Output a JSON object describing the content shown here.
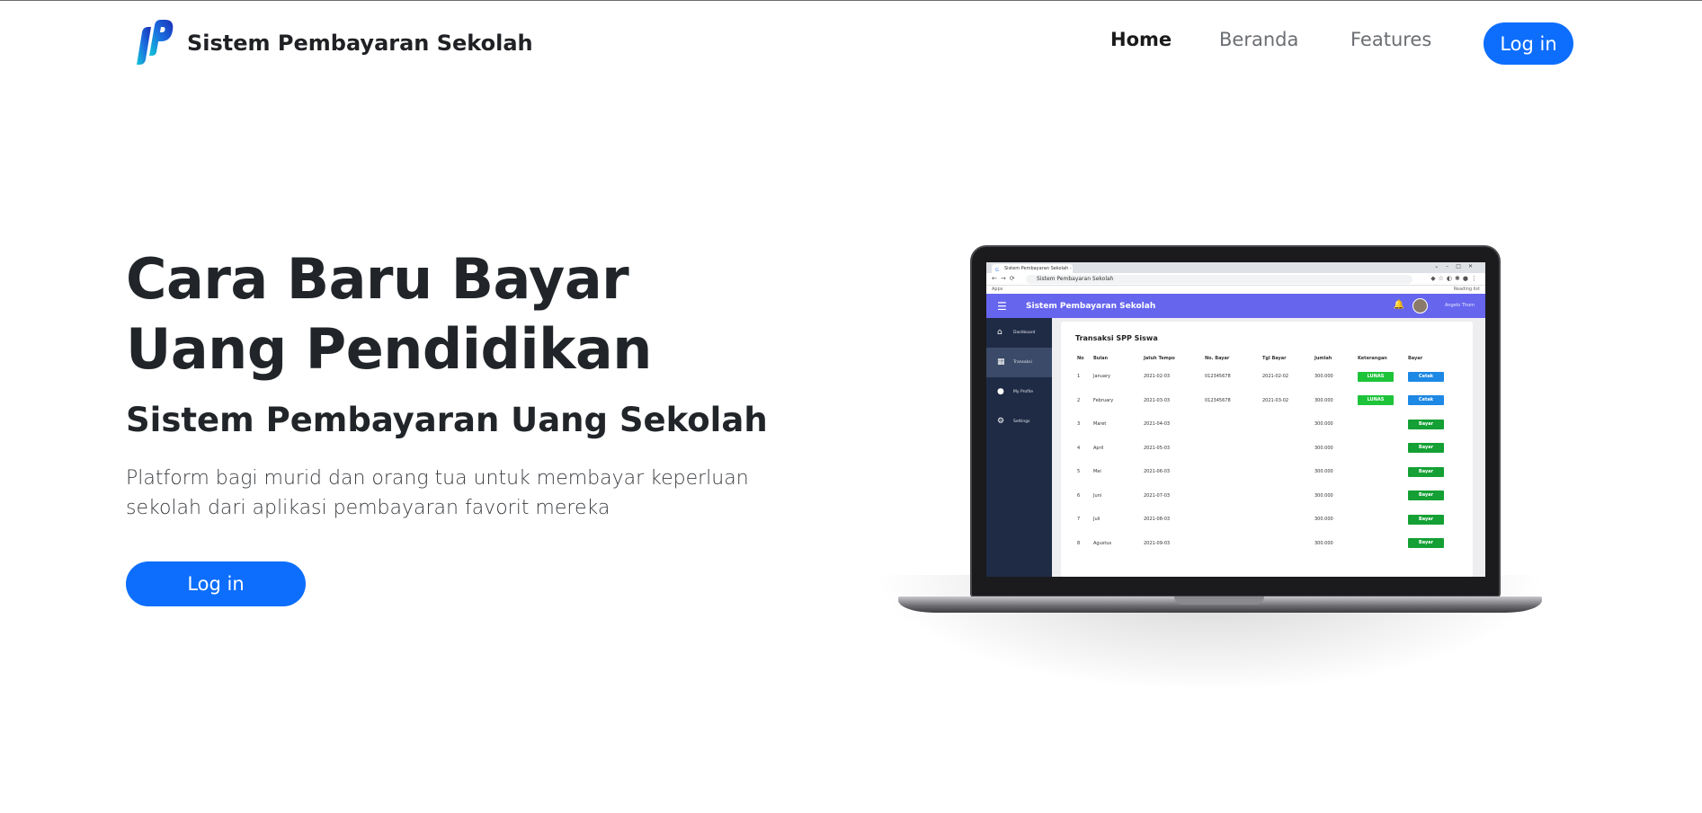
{
  "navbar": {
    "brand_text": "Sistem Pembayaran Sekolah",
    "links": {
      "home": "Home",
      "beranda": "Beranda",
      "features": "Features"
    },
    "login_label": "Log in"
  },
  "hero": {
    "title_line1": "Cara Baru Bayar",
    "title_line2": "Uang Pendidikan",
    "subtitle": "Sistem Pembayaran Uang Sekolah",
    "desc_line1": "Platform bagi murid dan orang tua untuk membayar keperluan",
    "desc_line2": "sekolah dari aplikasi pembayaran favorit mereka",
    "login_label": "Log in"
  },
  "colors": {
    "primary": "#0d6efd",
    "app_header": "#6665ee",
    "sidebar": "#1f2b45",
    "lunas": "#1dc43a",
    "cetak": "#1e88e5",
    "bayar": "#14a034"
  },
  "mockup": {
    "browser_tab": "Sistem Pembayaran Sekolah - Go",
    "url": "Sistem Pembayaran Sekolah",
    "bookmarks_left": "Apps",
    "bookmarks_right": "Reading list",
    "app_title": "Sistem Pembayaran Sekolah",
    "user_name": "Angelo Thom",
    "sidebar": [
      "Dashboard",
      "Transaksi",
      "My Profile",
      "Settings"
    ],
    "card_title": "Transaksi SPP Siswa",
    "headers": [
      "No",
      "Bulan",
      "Jatuh Tempo",
      "No. Bayar",
      "Tgl Bayar",
      "Jumlah",
      "Keterangan",
      "Bayar"
    ],
    "rows": [
      {
        "no": "1",
        "bulan": "January",
        "jatuh_tempo": "2021-02-03",
        "no_bayar": "012345678",
        "tgl_bayar": "2021-02-02",
        "jumlah": "300.000",
        "keterangan": "LUNAS",
        "bayar": "Cetak"
      },
      {
        "no": "2",
        "bulan": "February",
        "jatuh_tempo": "2021-03-03",
        "no_bayar": "012345678",
        "tgl_bayar": "2021-03-02",
        "jumlah": "300.000",
        "keterangan": "LUNAS",
        "bayar": "Cetak"
      },
      {
        "no": "3",
        "bulan": "Maret",
        "jatuh_tempo": "2021-04-03",
        "no_bayar": "",
        "tgl_bayar": "",
        "jumlah": "300.000",
        "keterangan": "",
        "bayar": "Bayar"
      },
      {
        "no": "4",
        "bulan": "April",
        "jatuh_tempo": "2021-05-03",
        "no_bayar": "",
        "tgl_bayar": "",
        "jumlah": "300.000",
        "keterangan": "",
        "bayar": "Bayar"
      },
      {
        "no": "5",
        "bulan": "Mei",
        "jatuh_tempo": "2021-06-03",
        "no_bayar": "",
        "tgl_bayar": "",
        "jumlah": "300.000",
        "keterangan": "",
        "bayar": "Bayar"
      },
      {
        "no": "6",
        "bulan": "Juni",
        "jatuh_tempo": "2021-07-03",
        "no_bayar": "",
        "tgl_bayar": "",
        "jumlah": "300.000",
        "keterangan": "",
        "bayar": "Bayar"
      },
      {
        "no": "7",
        "bulan": "Juli",
        "jatuh_tempo": "2021-08-03",
        "no_bayar": "",
        "tgl_bayar": "",
        "jumlah": "300.000",
        "keterangan": "",
        "bayar": "Bayar"
      },
      {
        "no": "8",
        "bulan": "Agustus",
        "jatuh_tempo": "2021-09-03",
        "no_bayar": "",
        "tgl_bayar": "",
        "jumlah": "300.000",
        "keterangan": "",
        "bayar": "Bayar"
      }
    ]
  }
}
